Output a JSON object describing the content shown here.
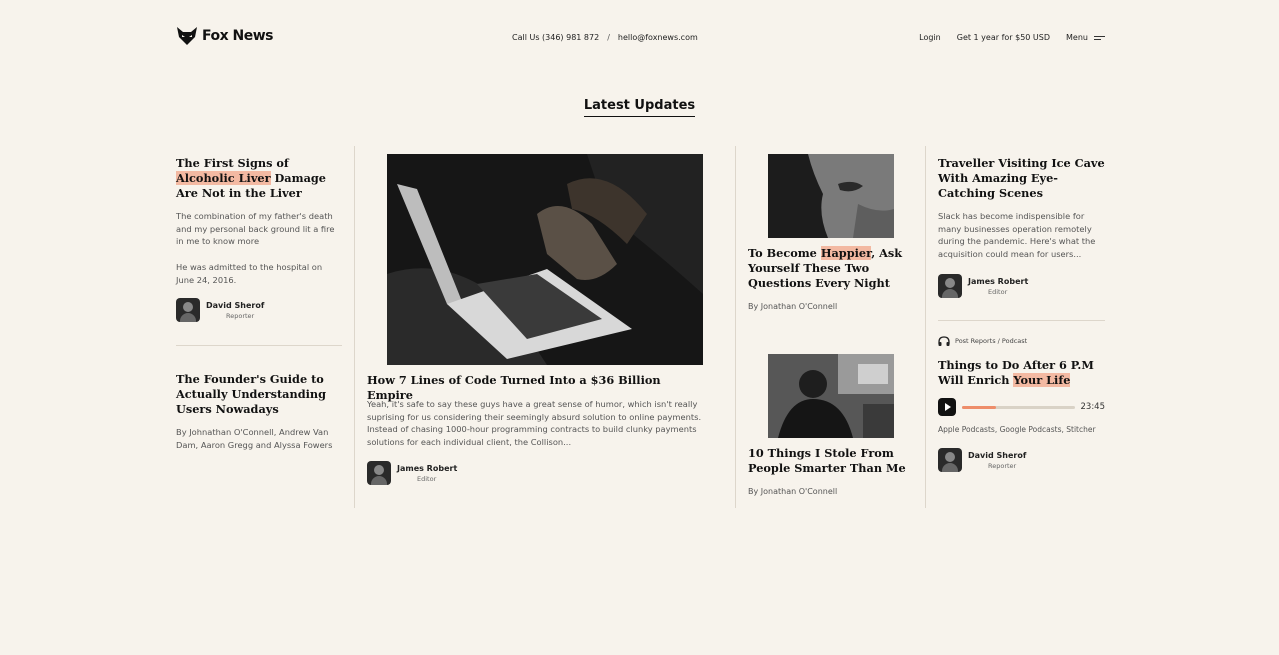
{
  "header": {
    "logo_text": "Fox News",
    "phone": "Call Us (346) 981 872",
    "separator": "/",
    "email": "hello@foxnews.com",
    "login": "Login",
    "subscribe": "Get 1 year for $50 USD",
    "menu": "Menu"
  },
  "section_title": "Latest Updates",
  "col1": {
    "a1": {
      "title_pre": "The First Signs of ",
      "title_hl": "Alcoholic Liver",
      "title_post": " Damage Are Not in the Liver",
      "p1": "The combination of my father's death and my personal back ground lit a fire in me to know more",
      "p2": "He was admitted to the hospital on June 24, 2016.",
      "author": "David Sherof",
      "role": "Reporter"
    },
    "a2": {
      "title": "The Founder's Guide to Actually Understanding Users Nowadays",
      "byline": "By Johnathan O'Connell, Andrew Van Dam, Aaron Gregg and Alyssa Fowers"
    }
  },
  "col2": {
    "title": "How 7 Lines of Code Turned Into a $36 Billion Empire",
    "body": "Yeah, it's safe to say these guys have a great sense of humor, which isn't really suprising for us considering their seemingly absurd solution to online payments. Instead of chasing 1000-hour programming contracts to build clunky payments solutions for each individual client, the Collison...",
    "author": "James Robert",
    "role": "Editor"
  },
  "col3": {
    "a1": {
      "title_pre": "To Become ",
      "title_hl": "Happier",
      "title_post": ", Ask Yourself These Two Questions Every Night",
      "byline": "By Jonathan O'Connell"
    },
    "a2": {
      "title": "10 Things I Stole From People Smarter Than Me",
      "byline": "By Jonathan O'Connell"
    }
  },
  "col4": {
    "a1": {
      "title": "Traveller Visiting Ice Cave With Amazing Eye-Catching Scenes",
      "body": "Slack has become indispensible for many businesses operation remotely during the pandemic. Here's what the acquisition could mean for users...",
      "author": "James Robert",
      "role": "Editor"
    },
    "podcast": {
      "tag": "Post Reports / Podcast",
      "title_pre": "Things to Do After 6 P.M Will Enrich ",
      "title_hl": "Your Life",
      "time": "23:45",
      "progress": 0.3,
      "platforms": "Apple Podcasts, Google Podcasts, Stitcher",
      "author": "David Sherof",
      "role": "Reporter"
    }
  },
  "colors": {
    "background": "#f7f3ec",
    "highlight": "#f3b9a2",
    "progress": "#ee8d6a"
  }
}
